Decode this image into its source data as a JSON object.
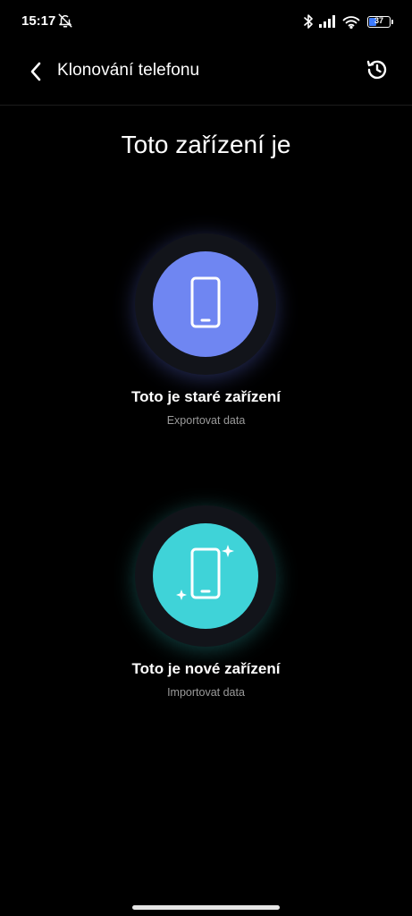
{
  "status_bar": {
    "time": "15:17",
    "battery_level": "37",
    "battery_fill_fraction": 0.37,
    "battery_color": "#3d7bff",
    "icons": [
      "bell-off-icon",
      "bluetooth-icon",
      "signal-icon",
      "wifi-icon",
      "battery-icon"
    ]
  },
  "app_bar": {
    "title": "Klonování telefonu",
    "back_icon": "chevron-left-icon",
    "history_icon": "history-icon"
  },
  "main": {
    "title": "Toto zařízení je",
    "options": [
      {
        "label": "Toto je staré zařízení",
        "sublabel": "Exportovat data",
        "icon": "phone-icon",
        "color": "#6f86f2"
      },
      {
        "label": "Toto je nové zařízení",
        "sublabel": "Importovat data",
        "icon": "phone-sparkle-icon",
        "color": "#3fd3d8"
      }
    ]
  }
}
